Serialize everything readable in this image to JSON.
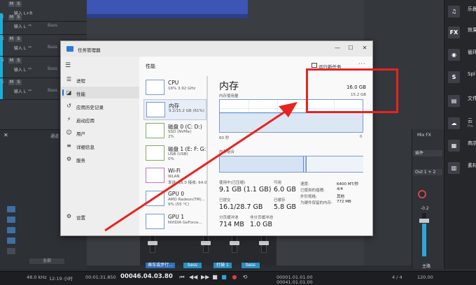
{
  "colors": {
    "accent": "#1a6fc9",
    "highlight": "#e8231f",
    "memory_line": "#4d7fc2",
    "daw_cyan": "#19b0d8"
  },
  "daw": {
    "tracks": [
      {
        "num": "",
        "mute": "M",
        "solo": "S",
        "input": "输入 L+R",
        "chev": "",
        "sel": ""
      },
      {
        "num": "2",
        "mute": "M",
        "solo": "S",
        "input": "输入 L",
        "chev": "⇔",
        "sel": "Bass"
      },
      {
        "num": "3",
        "mute": "M",
        "solo": "S",
        "input": "输入 L",
        "chev": "⇔",
        "sel": "Bass"
      },
      {
        "num": "4",
        "mute": "M",
        "solo": "S",
        "input": "输入 L",
        "chev": "⇔",
        "sel": "Bass"
      },
      {
        "num": "5",
        "mute": "M",
        "solo": "S",
        "input": "输入 L",
        "chev": "⇔",
        "sel": "Bass"
      }
    ],
    "mixer": {
      "close": "✕",
      "header": "通道",
      "bottom_label": "全部"
    },
    "channel_labels": [
      "乘车或步行...",
      "bass",
      "打鼓 1",
      "bass"
    ],
    "right_mixer": {
      "title": "Mix FX",
      "insert": "插件",
      "io": "Out 1 + 2",
      "gain": "-0.2",
      "pan": "<C>",
      "ch_label": "主路"
    }
  },
  "right_bar": [
    {
      "icon": "♫",
      "title": "乐器",
      "sub": ""
    },
    {
      "icon": "FX",
      "title": "效果",
      "sub": ""
    },
    {
      "icon": "◉",
      "title": "循环",
      "sub": ""
    },
    {
      "icon": "S",
      "title": "Spl",
      "sub": ""
    },
    {
      "icon": "▤",
      "title": "文件",
      "sub": ""
    },
    {
      "icon": "☁",
      "title": "云",
      "sub": "Pre"
    },
    {
      "icon": "▦",
      "title": "商店",
      "sub": ""
    },
    {
      "icon": "▥",
      "title": "素材",
      "sub": ""
    }
  ],
  "statusbar": {
    "sample_rate": "48.0 kHz",
    "duration": "12:19 小时",
    "time1": "00:01:31.850",
    "position": "00046.04.03.80",
    "bars": "00001.01.01.00",
    "bars2": "00041.01.01.00",
    "signature": "4 / 4",
    "tempo": "120.00"
  },
  "task_manager": {
    "title": "任务管理器",
    "nav": [
      {
        "icon": "☰",
        "label": "进程"
      },
      {
        "icon": "◪",
        "label": "性能"
      },
      {
        "icon": "↺",
        "label": "应用历史记录"
      },
      {
        "icon": "⚡",
        "label": "启动应用"
      },
      {
        "icon": "☺",
        "label": "用户"
      },
      {
        "icon": "≡",
        "label": "详细信息"
      },
      {
        "icon": "⚙",
        "label": "服务"
      }
    ],
    "settings_label": "设置",
    "page_title": "性能",
    "run_new_task": "运行新任务",
    "more": "···",
    "resources": [
      {
        "name": "CPU",
        "sub": "16% 3.92 GHz",
        "sub2": ""
      },
      {
        "name": "内存",
        "sub": "9.2/15.2 GB (61%)",
        "sub2": ""
      },
      {
        "name": "磁盘 0 (C: D:)",
        "sub": "SSD (NVMe)",
        "sub2": "2%"
      },
      {
        "name": "磁盘 1 (E: F: G:)",
        "sub": "USB (USB)",
        "sub2": "0%"
      },
      {
        "name": "Wi-Fi",
        "sub": "WLAN",
        "sub2": "发送: 16.0 接收: 64.0"
      },
      {
        "name": "GPU 0",
        "sub": "AMD Radeon(TM)...",
        "sub2": "9% (55 °C)"
      },
      {
        "name": "GPU 1",
        "sub": "NVIDIA GeForce...",
        "sub2": ""
      }
    ],
    "memory": {
      "title": "内存",
      "total": "16.0 GB",
      "usage_label": "内存使用量",
      "usage_max": "15.2 GB",
      "usage_fraction": 0.61,
      "axis_left": "60 秒",
      "axis_right": "0",
      "composition_label": "内存组合",
      "stats": {
        "in_use_label": "使用中(已压缩)",
        "in_use": "9.1 GB (1.1 GB)",
        "available_label": "可用",
        "available": "6.0 GB",
        "committed_label": "已提交",
        "committed": "16.1/28.7 GB",
        "cached_label": "已缓存",
        "cached": "5.8 GB",
        "paged_label": "分页缓冲池",
        "paged": "714 MB",
        "nonpaged_label": "非分页缓冲池",
        "nonpaged": "1.0 GB"
      },
      "details": [
        {
          "k": "速度:",
          "v": "6400 MT/秒"
        },
        {
          "k": "已使用的插槽:",
          "v": "4/4"
        },
        {
          "k": "外形规格:",
          "v": "其他"
        },
        {
          "k": "为硬件保留的内存:",
          "v": "772 MB"
        }
      ]
    }
  }
}
